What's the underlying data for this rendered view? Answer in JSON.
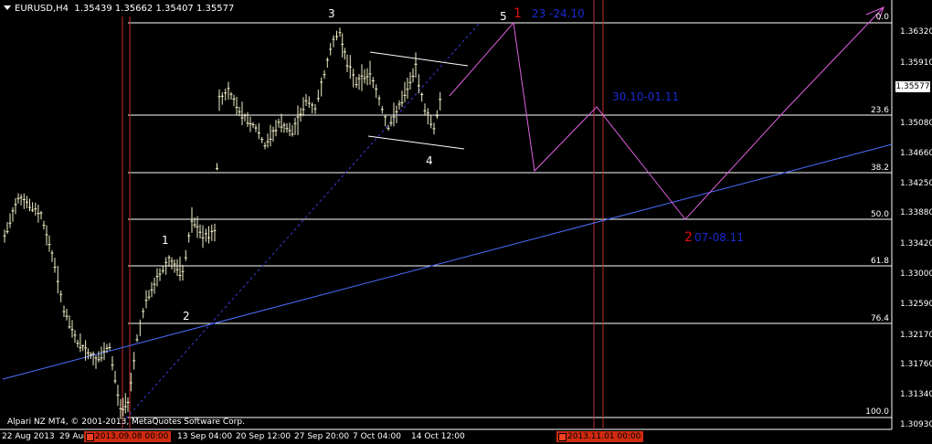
{
  "header": {
    "symbol_timeframe": "EURUSD,H4",
    "ohlc": "1.35439 1.35662 1.35407 1.35577"
  },
  "price_axis": {
    "ticks": [
      "1.36320",
      "1.35910",
      "1.35080",
      "1.34660",
      "1.34250",
      "1.33880",
      "1.33420",
      "1.33000",
      "1.32590",
      "1.32170",
      "1.31760",
      "1.31340",
      "1.30930"
    ],
    "current_price": "1.35577"
  },
  "time_axis": {
    "ticks": [
      "22 Aug 2013",
      "29 Aug",
      "13 Sep 04:00",
      "20 Sep 12:00",
      "27 Sep 20:00",
      "7 Oct 04:00",
      "14 Oct 12:00"
    ]
  },
  "date_tags": [
    "2013.09.08 00:00",
    "2013.11.01 00:00"
  ],
  "fib_levels": [
    "0.0",
    "23.6",
    "38.2",
    "50.0",
    "61.8",
    "76.4",
    "100.0"
  ],
  "wave_labels": {
    "w1": "1",
    "w2": "2",
    "w3": "3",
    "w4": "4",
    "w5": "5"
  },
  "annotations": {
    "target1_num": "1",
    "target1_dates": "23 -24.10",
    "mid_dates": "30.10-01.11",
    "target2_num": "2",
    "target2_dates": "07-08.11"
  },
  "copyright": "Alpari NZ MT4, © 2001-2013, MetaQuotes Software Corp.",
  "colors": {
    "background": "#000000",
    "candles": "#f0efc8",
    "fib_lines": "#ffffff",
    "vertical_lines": "#c03030",
    "trendline": "#4d6fff",
    "projection": "#e060e0",
    "annotation_blue": "#1a2ad0",
    "annotation_red": "#e01010"
  }
}
